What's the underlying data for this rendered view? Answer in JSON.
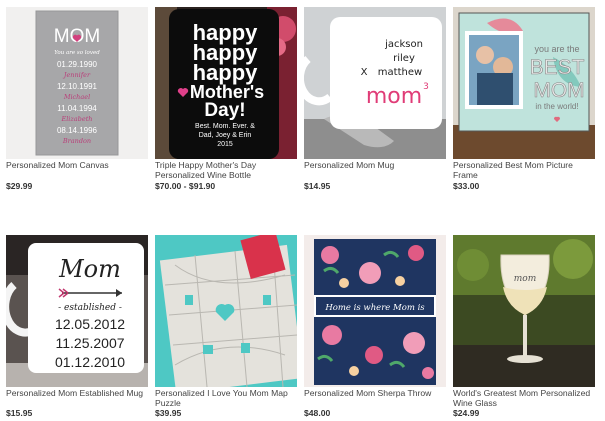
{
  "products": [
    {
      "name": "Personalized Mom Canvas",
      "price": "$29.99",
      "art": {
        "word": "MOM",
        "lines": [
          "You are so loved",
          "01.29.1990",
          "Jennifer",
          "12.10.1991",
          "Michael",
          "11.04.1994",
          "Elizabeth",
          "08.14.1996",
          "Brandon"
        ]
      }
    },
    {
      "name": "Triple Happy Mother's Day Personalized Wine Bottle",
      "price": "$70.00 - $91.90",
      "art": {
        "lines": [
          "happy",
          "happy",
          "happy",
          "Mother's",
          "Day!",
          "Best. Mom. Ever. &",
          "Dad, Joey & Erin",
          "2015"
        ]
      }
    },
    {
      "name": "Personalized Mom Mug",
      "price": "$14.95",
      "art": {
        "names": [
          "jackson",
          "riley",
          "matthew"
        ],
        "word": "mom",
        "sup": "3",
        "mark": "X"
      }
    },
    {
      "name": "Personalized Best Mom Picture Frame",
      "price": "$33.00",
      "art": {
        "lines": [
          "you are the",
          "BEST",
          "MOM",
          "in the world!"
        ]
      }
    },
    {
      "name": "Personalized Mom Established Mug",
      "price": "$15.95",
      "art": {
        "word": "Mom",
        "sub": "- established -",
        "dates": [
          "12.05.2012",
          "11.25.2007",
          "01.12.2010"
        ]
      }
    },
    {
      "name": "Personalized I Love You Mom Map Puzzle",
      "price": "$39.95",
      "art": {}
    },
    {
      "name": "Personalized Mom Sherpa Throw",
      "price": "$48.00",
      "art": {
        "banner": "Home is where Mom is"
      }
    },
    {
      "name": "World's Greatest Mom Personalized Wine Glass",
      "price": "$24.99",
      "art": {
        "word": "mom"
      }
    }
  ]
}
